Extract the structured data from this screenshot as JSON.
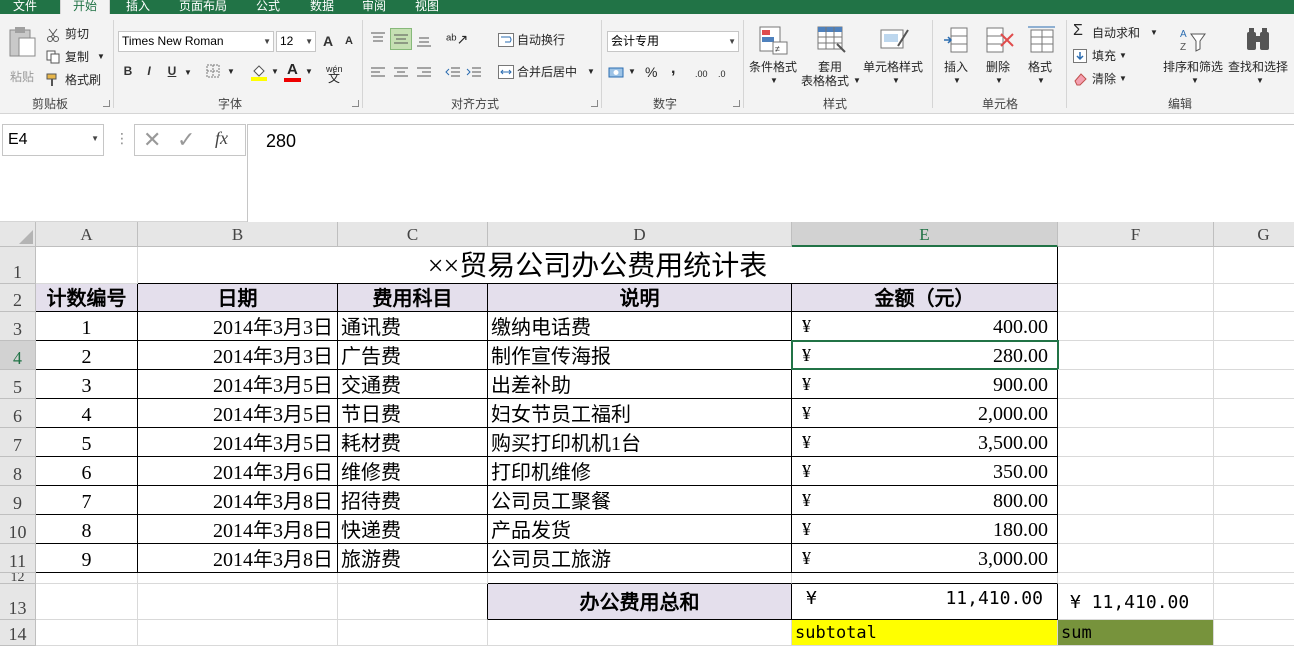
{
  "tabs": [
    "文件",
    "开始",
    "插入",
    "页面布局",
    "公式",
    "数据",
    "审阅",
    "视图"
  ],
  "ribbon": {
    "clipboard": {
      "paste": "粘贴",
      "cut": "剪切",
      "copy": "复制",
      "format_painter": "格式刷",
      "label": "剪贴板"
    },
    "font": {
      "name": "Times New Roman",
      "size": "12",
      "label": "字体",
      "bold": "B",
      "italic": "I",
      "underline": "U",
      "grow": "A",
      "shrink": "A",
      "wen": "wén"
    },
    "alignment": {
      "wrap": "自动换行",
      "merge": "合并后居中",
      "label": "对齐方式"
    },
    "number": {
      "format": "会计专用",
      "percent": "%",
      "comma": ",",
      "inc": ".00",
      "dec": ".0",
      "label": "数字"
    },
    "styles": {
      "conditional": "条件格式",
      "table1": "套用",
      "table2": "表格格式",
      "cell": "单元格样式",
      "label": "样式"
    },
    "cells": {
      "insert": "插入",
      "delete": "删除",
      "format": "格式",
      "label": "单元格"
    },
    "editing": {
      "autosum": "自动求和",
      "fill": "填充",
      "clear": "清除",
      "sort": "排序和筛选",
      "find": "查找和选择",
      "label": "编辑"
    }
  },
  "formula_bar": {
    "name_box": "E4",
    "fx": "fx",
    "value": "280"
  },
  "columns": [
    "A",
    "B",
    "C",
    "D",
    "E",
    "F",
    "G"
  ],
  "rows": [
    "1",
    "2",
    "3",
    "4",
    "5",
    "6",
    "7",
    "8",
    "9",
    "10",
    "11",
    "12",
    "13",
    "14"
  ],
  "sheet": {
    "title": "××贸易公司办公费用统计表",
    "headers": [
      "计数编号",
      "日期",
      "费用科目",
      "说明",
      "金额（元）"
    ],
    "data": [
      [
        "1",
        "2014年3月3日",
        "通讯费",
        "缴纳电话费",
        "¥",
        "400.00"
      ],
      [
        "2",
        "2014年3月3日",
        "广告费",
        "制作宣传海报",
        "¥",
        "280.00"
      ],
      [
        "3",
        "2014年3月5日",
        "交通费",
        "出差补助",
        "¥",
        "900.00"
      ],
      [
        "4",
        "2014年3月5日",
        "节日费",
        "妇女节员工福利",
        "¥",
        "2,000.00"
      ],
      [
        "5",
        "2014年3月5日",
        "耗材费",
        "购买打印机机1台",
        "¥",
        "3,500.00"
      ],
      [
        "6",
        "2014年3月6日",
        "维修费",
        "打印机维修",
        "¥",
        "350.00"
      ],
      [
        "7",
        "2014年3月8日",
        "招待费",
        "公司员工聚餐",
        "¥",
        "800.00"
      ],
      [
        "8",
        "2014年3月8日",
        "快递费",
        "产品发货",
        "¥",
        "180.00"
      ],
      [
        "9",
        "2014年3月8日",
        "旅游费",
        "公司员工旅游",
        "¥",
        "3,000.00"
      ]
    ],
    "total_label": "办公费用总和",
    "total_currency": "¥",
    "total_value": "11,410.00",
    "f13": "¥  11,410.00",
    "e14": "subtotal",
    "f14": "sum"
  },
  "colors": {
    "excel_green": "#217346",
    "header_fill": "#e4dfec",
    "subtotal_fill": "#ffff00",
    "sum_fill": "#77933c"
  }
}
